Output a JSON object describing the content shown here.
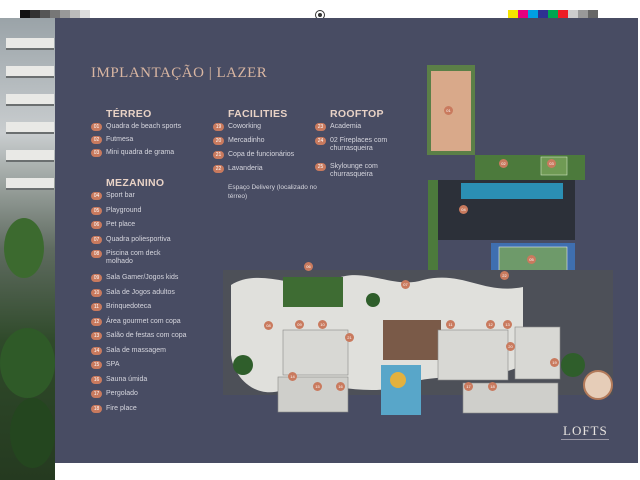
{
  "title": "IMPLANTAÇÃO | LAZER",
  "sections": {
    "terreo": {
      "title": "TÉRREO",
      "items": [
        {
          "n": "01",
          "label": "Quadra de beach sports"
        },
        {
          "n": "02",
          "label": "Futmesa"
        },
        {
          "n": "03",
          "label": "Mini quadra de grama"
        }
      ]
    },
    "mezanino": {
      "title": "MEZANINO",
      "items": [
        {
          "n": "04",
          "label": "Sport bar"
        },
        {
          "n": "05",
          "label": "Playground"
        },
        {
          "n": "06",
          "label": "Pet place"
        },
        {
          "n": "07",
          "label": "Quadra poliesportiva"
        },
        {
          "n": "08",
          "label": "Piscina com deck molhado"
        },
        {
          "n": "09",
          "label": "Sala Gamer/Jogos kids"
        },
        {
          "n": "10",
          "label": "Sala de Jogos adultos"
        },
        {
          "n": "11",
          "label": "Brinquedoteca"
        },
        {
          "n": "12",
          "label": "Área gourmet com copa"
        },
        {
          "n": "13",
          "label": "Salão de festas com copa"
        },
        {
          "n": "14",
          "label": "Sala de massagem"
        },
        {
          "n": "15",
          "label": "SPA"
        },
        {
          "n": "16",
          "label": "Sauna úmida"
        },
        {
          "n": "17",
          "label": "Pergolado"
        },
        {
          "n": "18",
          "label": "Fire place"
        }
      ]
    },
    "facilities": {
      "title": "FACILITIES",
      "items": [
        {
          "n": "19",
          "label": "Coworking"
        },
        {
          "n": "20",
          "label": "Mercadinho"
        },
        {
          "n": "21",
          "label": "Copa de funcionários"
        },
        {
          "n": "22",
          "label": "Lavanderia"
        }
      ],
      "note": "Espaço Delivery (localizado no térreo)"
    },
    "rooftop": {
      "title": "ROOFTOP",
      "items": [
        {
          "n": "23",
          "label": "Academia"
        },
        {
          "n": "24",
          "label": "02 Fireplaces com churrasqueira"
        },
        {
          "n": "25",
          "label": "Skylounge com churrasqueira"
        }
      ]
    }
  },
  "plan_labels": [
    "01",
    "02",
    "03",
    "04",
    "05",
    "06",
    "07",
    "08",
    "09",
    "10",
    "11",
    "12",
    "13",
    "14",
    "15",
    "16",
    "17",
    "18",
    "19",
    "20",
    "21",
    "22"
  ],
  "logo": "LOFTS",
  "colors": {
    "board": "#484c63",
    "accent": "#c97a5e",
    "title": "#d9b6a2"
  }
}
